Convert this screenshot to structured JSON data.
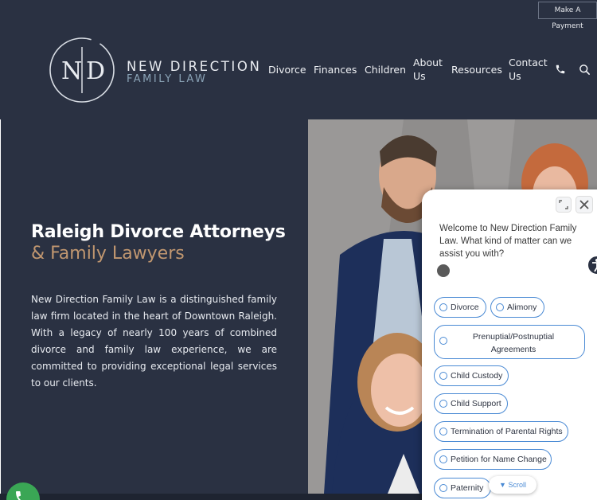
{
  "header": {
    "payment_button": "Make A Payment",
    "logo": {
      "monogram": "N|D",
      "line1": "NEW DIRECTION",
      "line2": "FAMILY LAW"
    },
    "nav": [
      {
        "label": "Divorce"
      },
      {
        "label": "Finances"
      },
      {
        "label": "Children"
      },
      {
        "label": "About Us"
      },
      {
        "label": "Resources"
      },
      {
        "label": "Contact Us"
      }
    ],
    "icons": [
      "phone-icon",
      "search-icon"
    ]
  },
  "hero": {
    "title_line1": "Raleigh Divorce Attorneys",
    "title_line2": "& Family Lawyers",
    "body": "New Direction Family Law is a distinguished family law firm located in the heart of Downtown Raleigh. With a legacy of nearly 100 years of combined divorce and family law experience, we are committed to providing exceptional legal services to our clients."
  },
  "chat": {
    "message": "Welcome to New Direction Family Law. What kind of matter can we assist you with?",
    "options": [
      "Divorce",
      "Alimony",
      "Prenuptial/Postnuptial Agreements",
      "Child Custody",
      "Child Support",
      "Termination of Parental Rights",
      "Petition for Name Change",
      "Paternity"
    ],
    "scroll_label": "Scroll"
  },
  "colors": {
    "navy": "#2a3142",
    "gold": "#c19770",
    "accent_blue": "#4a8ad4",
    "phone_green": "#3aa655"
  }
}
